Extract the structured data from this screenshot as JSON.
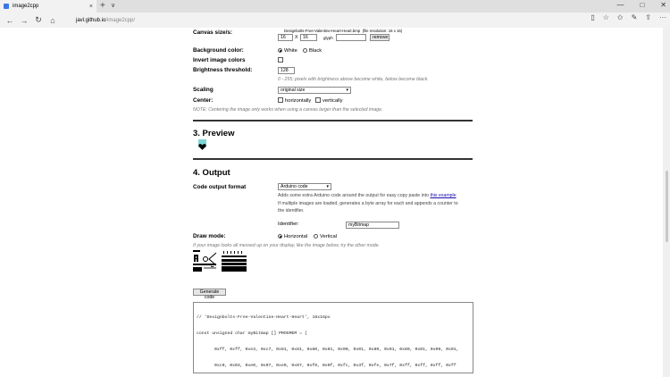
{
  "browser": {
    "tab_title": "image2cpp",
    "tab_close": "×",
    "new_tab": "+",
    "tab_menu": "∨",
    "win_min": "—",
    "win_max": "□",
    "win_close": "✕",
    "back": "←",
    "forward": "→",
    "refresh": "↻",
    "home": "⌂",
    "url_host": "javl.github.io",
    "url_path": "/image2cpp/",
    "reading_view": "▯",
    "favorites": "☆",
    "favorites_bar": "✩",
    "pen": "✎",
    "share": "⇪",
    "more": "···"
  },
  "canvas": {
    "label": "Canvas size/s:",
    "file_name": "Designbolts-Free-Valentine-Heart-Heart.bmp",
    "file_res": "(file resolution: 16 x 16)",
    "width": "16",
    "x_label": "X",
    "height": "16",
    "unit": "glyph",
    "glyph_value": "",
    "remove_label": "remove"
  },
  "background": {
    "label": "Background color:",
    "white": "White",
    "black": "Black"
  },
  "invert": {
    "label": "Invert image colors"
  },
  "brightness": {
    "label": "Brightness threshold:",
    "value": "128",
    "note": "0 - 255; pixels with brightness above become white, below become black."
  },
  "scaling": {
    "label": "Scaling",
    "selected": "original size"
  },
  "center": {
    "label": "Center:",
    "horizontally": "horizontally",
    "vertically": "vertically",
    "note": "NOTE: Centering the image only works when using a canvas larger than the selected image."
  },
  "preview": {
    "heading": "3. Preview"
  },
  "output": {
    "heading": "4. Output",
    "format_label": "Code output format",
    "format_selected": "Arduino code",
    "desc1": "Adds some extra Arduino code around the output for easy copy paste into",
    "desc_link": "this example",
    "desc2": "If multiple images are loaded, generates a byte array for each and appends a counter to",
    "desc3": "the identifier.",
    "identifier_label": "Identifier:",
    "identifier_value": "myBitmap",
    "draw_mode_label": "Draw mode:",
    "horizontal": "Horizontal",
    "vertical": "Vertical",
    "draw_note": "If your image looks all messed up on your display, like the image below, try the other mode.",
    "generate_label": "Generate code",
    "code": [
      "// 'Designbolts-Free-Valentine-Heart-Heart', 16x16px",
      "const unsigned char myBitmap [] PROGMEM = {",
      "0xff, 0xff, 0xe3, 0xc7, 0x81, 0x81, 0x80, 0x01, 0x00, 0x01, 0x80, 0x01, 0x80, 0x01, 0x00, 0x01,",
      "0xc0, 0x03, 0xe0, 0x07, 0xe0, 0x07, 0xf0, 0x0f, 0xfc, 0x3f, 0xfe, 0x7f, 0xff, 0xff, 0xff, 0xff",
      "};"
    ]
  }
}
